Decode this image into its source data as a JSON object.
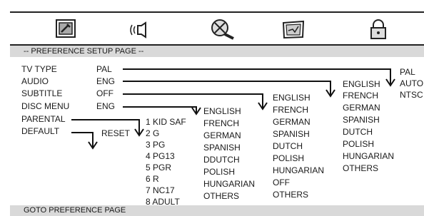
{
  "icons": [
    {
      "name": "general-setup-icon",
      "label": "general-setup"
    },
    {
      "name": "audio-setup-icon",
      "label": "speaker"
    },
    {
      "name": "video-setup-icon",
      "label": "film-reel"
    },
    {
      "name": "preference-setup-icon",
      "label": "tv-screen"
    },
    {
      "name": "password-setup-icon",
      "label": "padlock"
    }
  ],
  "page_title": "-- PREFERENCE SETUP PAGE --",
  "settings": [
    {
      "label": "TV TYPE",
      "value": "PAL"
    },
    {
      "label": "AUDIO",
      "value": "ENG"
    },
    {
      "label": "SUBTITLE",
      "value": "OFF"
    },
    {
      "label": "DISC MENU",
      "value": "ENG"
    },
    {
      "label": "PARENTAL",
      "value": ""
    },
    {
      "label": "DEFAULT",
      "value": ""
    }
  ],
  "submenus": {
    "tv_type": [
      "PAL",
      "AUTO",
      "NTSC"
    ],
    "audio": [
      "ENGLISH",
      "FRENCH",
      "GERMAN",
      "SPANISH",
      "DUTCH",
      "POLISH",
      "HUNGARIAN",
      "OTHERS"
    ],
    "subtitle": [
      "ENGLISH",
      "FRENCH",
      "GERMAN",
      "SPANISH",
      "DUTCH",
      "POLISH",
      "HUNGARIAN",
      "OFF",
      "OTHERS"
    ],
    "disc_menu": [
      "ENGLISH",
      "FRENCH",
      "GERMAN",
      "SPANISH",
      "DDUTCH",
      "POLISH",
      "HUNGARIAN",
      "OTHERS"
    ],
    "parental": [
      "1 KID SAF",
      "2 G",
      "3 PG",
      "4 PG13",
      "5 PGR",
      "6 R",
      "7 NC17",
      "8 ADULT"
    ],
    "default": [
      "RESET"
    ]
  },
  "footer_text": "GOTO PREFERENCE PAGE",
  "colors": {
    "header_bar": "#d9d9d9",
    "text": "#1a1a1a",
    "lines": "#111111"
  }
}
